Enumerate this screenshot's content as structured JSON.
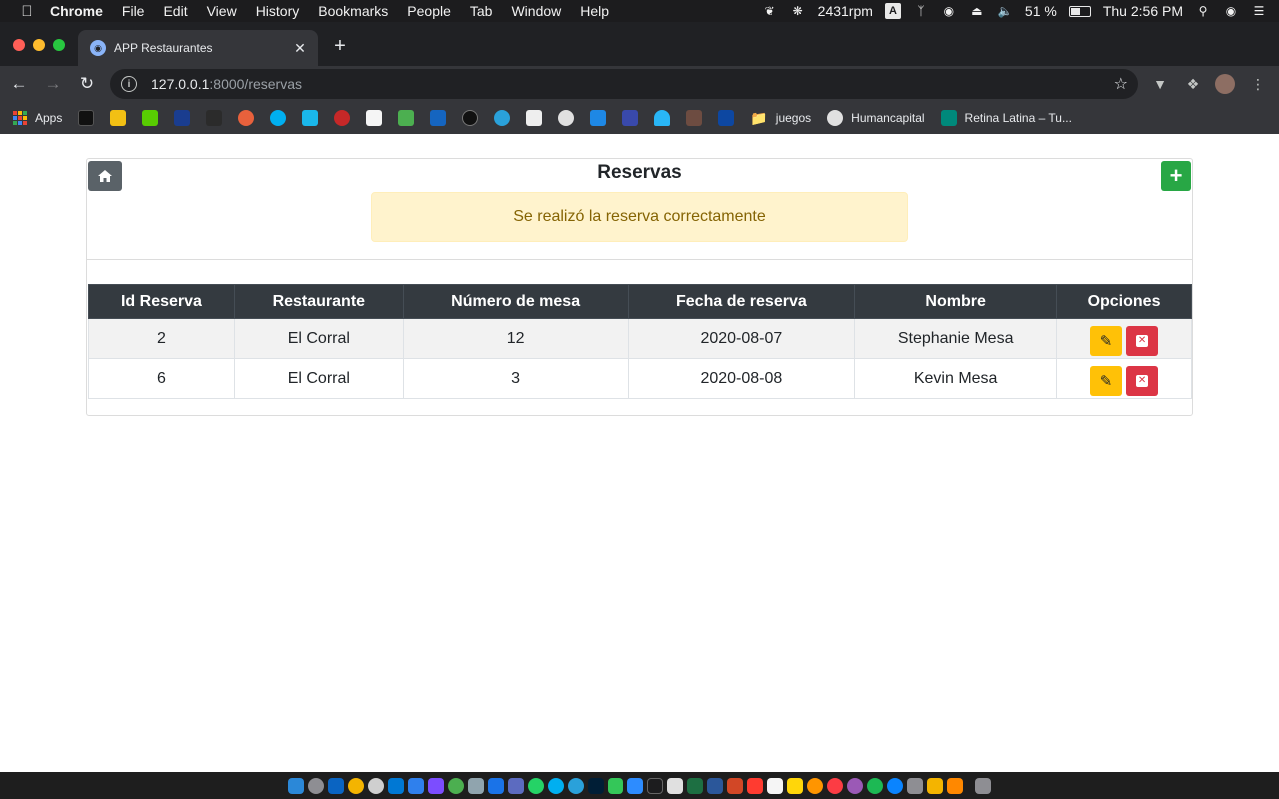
{
  "menubar": {
    "app_name": "Chrome",
    "items": [
      "File",
      "Edit",
      "View",
      "History",
      "Bookmarks",
      "People",
      "Tab",
      "Window",
      "Help"
    ],
    "fan_speed": "2431rpm",
    "input_source": "A",
    "battery": "51 %",
    "clock": "Thu 2:56 PM"
  },
  "browser": {
    "tab_title": "APP Restaurantes",
    "url_host": "127.0.0.1",
    "url_path": ":8000/reservas",
    "bookmarks": {
      "apps_label": "Apps",
      "juegos": "juegos",
      "humancapital": "Humancapital",
      "retina": "Retina Latina – Tu..."
    }
  },
  "page": {
    "title": "Reservas",
    "alert": "Se realizó la reserva correctamente",
    "table": {
      "headers": [
        "Id Reserva",
        "Restaurante",
        "Número de mesa",
        "Fecha de reserva",
        "Nombre",
        "Opciones"
      ],
      "rows": [
        [
          "2",
          "El Corral",
          "12",
          "2020-08-07",
          "Stephanie Mesa"
        ],
        [
          "6",
          "El Corral",
          "3",
          "2020-08-08",
          "Kevin Mesa"
        ]
      ]
    }
  },
  "colors": {
    "header_bg": "#343a40",
    "success": "#28a745",
    "warning": "#ffc107",
    "danger": "#dc3545",
    "alert_bg": "#fff3cd",
    "alert_text": "#856404"
  }
}
